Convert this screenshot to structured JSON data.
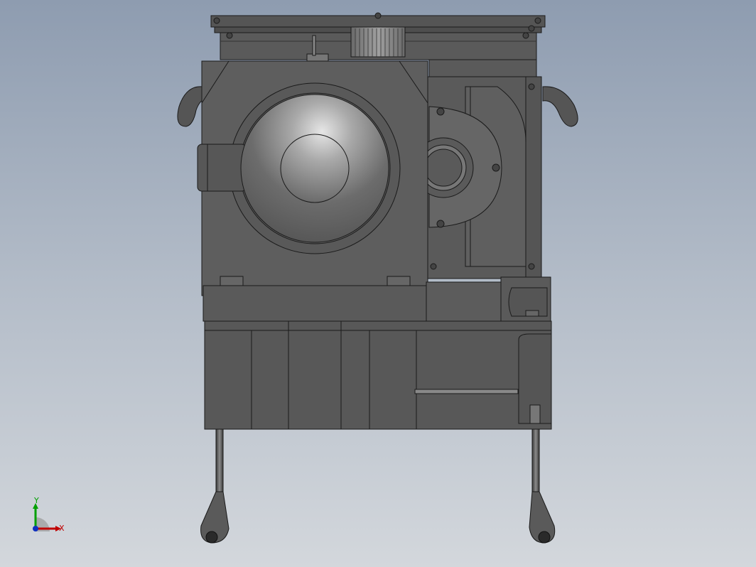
{
  "app": {
    "view": "cad-3d-viewport"
  },
  "triad": {
    "x_label": "X",
    "y_label": "Y"
  },
  "colors": {
    "background_top": "#8e9cb0",
    "background_bottom": "#d3d7dc",
    "body": "#5e5e5e",
    "body_dark": "#4e4e4e",
    "edge": "#1a1a1a",
    "axis_x": "#c00000",
    "axis_y": "#00a000",
    "axis_z": "#1030c0"
  },
  "model": {
    "name_icon": "gear-reducer-assembly",
    "parts": [
      "top-cover",
      "gear",
      "motor-housing",
      "motor-dome",
      "flange",
      "base-block",
      "lifting-rods",
      "lifting-hooks"
    ]
  }
}
